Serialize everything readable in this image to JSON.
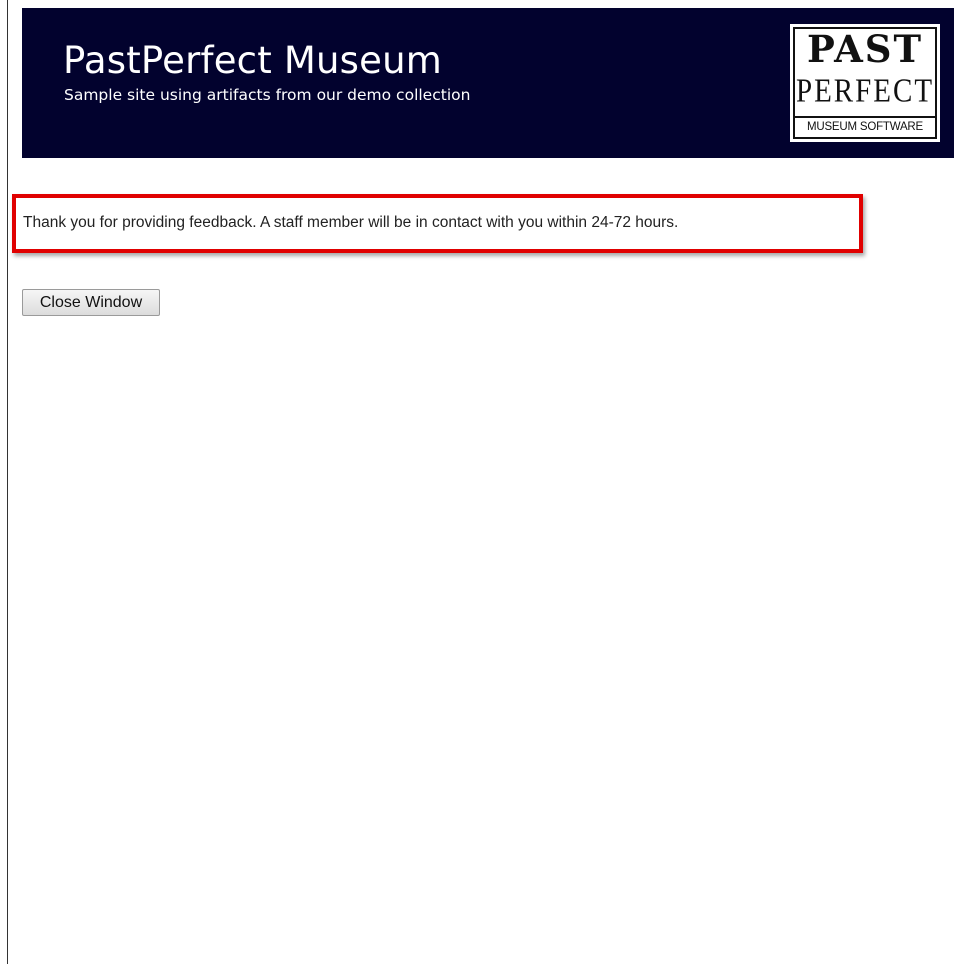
{
  "header": {
    "title": "PastPerfect Museum",
    "subtitle": "Sample site using artifacts from our demo collection",
    "background_color": "#02022e",
    "logo": {
      "line1": "PAST",
      "line2": "PERFECT",
      "line3": "MUSEUM SOFTWARE"
    }
  },
  "main": {
    "confirmation_message": "Thank you for providing feedback. A staff member will be in contact with you within 24-72 hours.",
    "highlight_color": "#e00000",
    "close_button_label": "Close Window"
  }
}
